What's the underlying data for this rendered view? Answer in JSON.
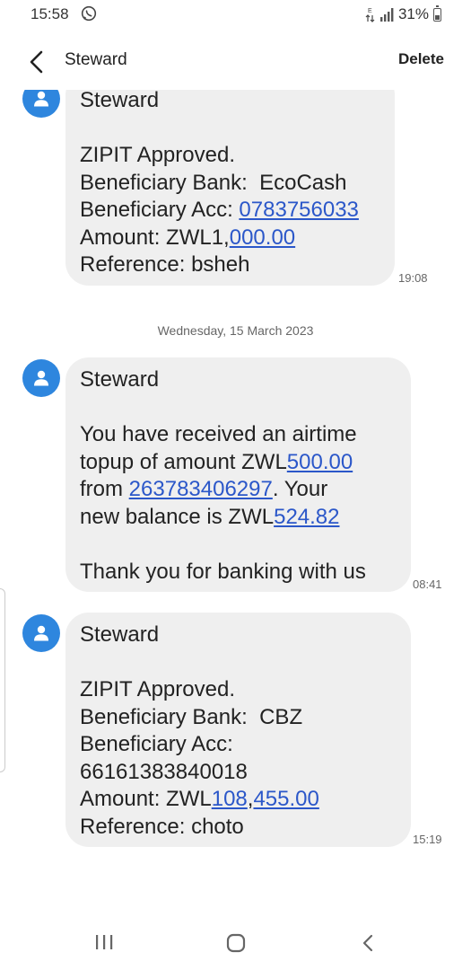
{
  "status_bar": {
    "time": "15:58",
    "battery": "31%"
  },
  "header": {
    "title": "Steward",
    "delete_label": "Delete"
  },
  "date_separator": "Wednesday, 15 March 2023",
  "messages": [
    {
      "sender": "Steward",
      "line1": "ZIPIT Approved.",
      "line2": "Beneficiary Bank:  EcoCash",
      "line3_prefix": "Beneficiary Acc: ",
      "line3_link": "0783756033",
      "line4_prefix": "Amount: ZWL1,",
      "line4_link": "000.00",
      "line5": "Reference: bsheh",
      "time": "19:08"
    },
    {
      "sender": "Steward",
      "line1": "You have received an airtime",
      "line2_prefix": "topup of amount ZWL",
      "line2_link": "500.00",
      "line3_prefix": "from ",
      "line3_link": "263783406297",
      "line3_suffix": ". Your",
      "line4_prefix": "new balance is ZWL",
      "line4_link": "524.82",
      "line5": "Thank you for banking with us",
      "time": "08:41"
    },
    {
      "sender": "Steward",
      "line1": "ZIPIT Approved.",
      "line2": "Beneficiary Bank:  CBZ",
      "line3": "Beneficiary Acc:",
      "line4": "66161383840018",
      "line5_prefix": "Amount: ZWL",
      "line5_link1": "108",
      "line5_sep": ",",
      "line5_link2": "455.00",
      "line6": "Reference: choto",
      "time": "15:19"
    }
  ],
  "icons": {
    "status": [
      "whatsapp-icon",
      "data-icon",
      "signal-icon",
      "battery-icon"
    ],
    "header": [
      "back-arrow-icon"
    ],
    "avatar": "person-icon",
    "nav": [
      "recent-apps-icon",
      "home-icon",
      "back-icon"
    ]
  }
}
